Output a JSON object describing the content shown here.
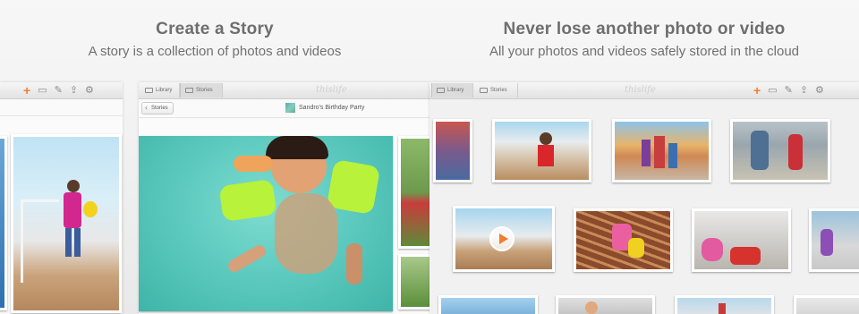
{
  "left_hero": {
    "title": "Create a Story",
    "subtitle": "A story is a collection of photos and videos"
  },
  "right_hero": {
    "title": "Never lose another photo or video",
    "subtitle": "All your photos and videos safely stored in the cloud"
  },
  "app": {
    "brand": "thislife",
    "tabs": [
      {
        "label": "Library"
      },
      {
        "label": "Stories"
      }
    ],
    "back_label": "Stories",
    "story_title": "Sandro's Birthday Party"
  },
  "colors": {
    "accent": "#f47c2a",
    "pool": "#5fcbc0"
  }
}
